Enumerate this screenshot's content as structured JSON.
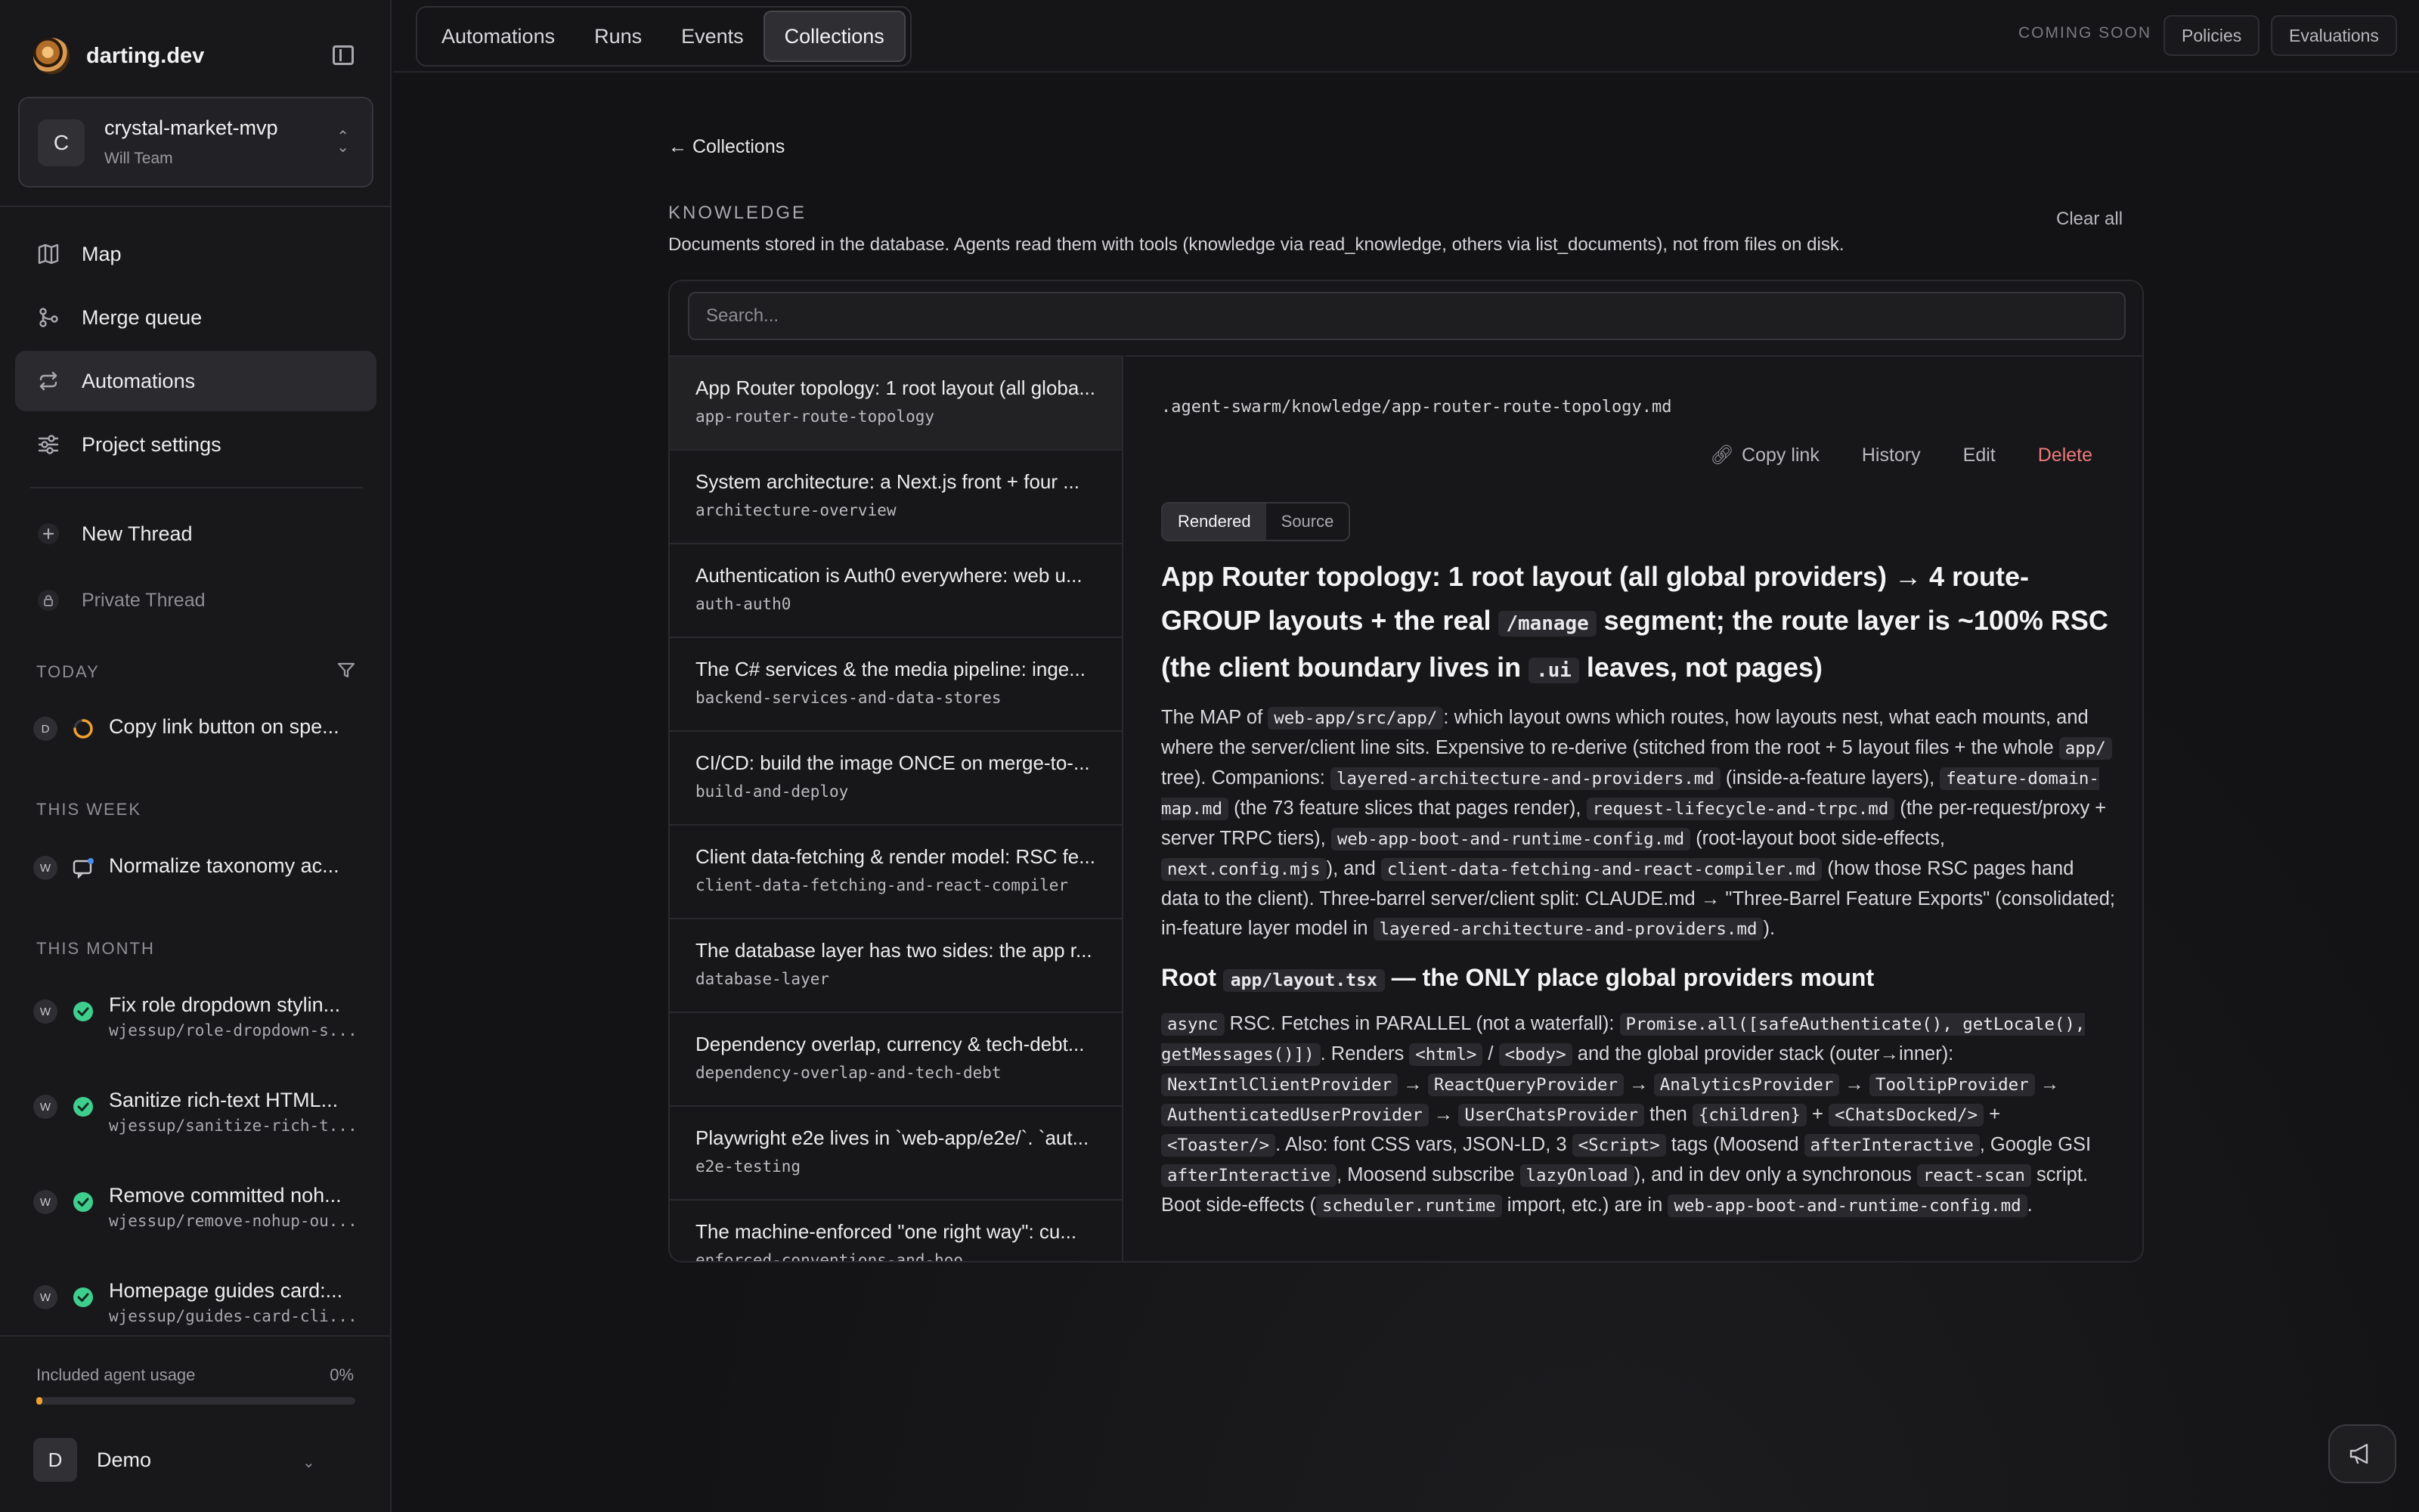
{
  "brand": {
    "name": "darting.dev"
  },
  "workspace": {
    "initial": "C",
    "name": "crystal-market-mvp",
    "team": "Will Team"
  },
  "nav": {
    "map": "Map",
    "merge_queue": "Merge queue",
    "automations": "Automations",
    "project_settings": "Project settings",
    "new_thread": "New Thread",
    "private_thread": "Private Thread"
  },
  "sections": {
    "today": "TODAY",
    "this_week": "THIS WEEK",
    "this_month": "THIS MONTH"
  },
  "threads": [
    {
      "avatar": "D",
      "title": "Copy link button on spe...",
      "sub": "",
      "status": "running"
    },
    {
      "avatar": "W",
      "title": "Normalize taxonomy ac...",
      "sub": "",
      "status": "chat"
    },
    {
      "avatar": "W",
      "title": "Fix role dropdown stylin...",
      "sub": "wjessup/role-dropdown-s...",
      "status": "done"
    },
    {
      "avatar": "W",
      "title": "Sanitize rich-text HTML...",
      "sub": "wjessup/sanitize-rich-t...",
      "status": "done"
    },
    {
      "avatar": "W",
      "title": "Remove committed noh...",
      "sub": "wjessup/remove-nohup-ou...",
      "status": "done"
    },
    {
      "avatar": "W",
      "title": "Homepage guides card:...",
      "sub": "wjessup/guides-card-cli...",
      "status": "done"
    }
  ],
  "usage": {
    "label": "Included agent usage",
    "percent_text": "0%",
    "percent": 0
  },
  "user": {
    "initial": "D",
    "name": "Demo"
  },
  "topbar": {
    "tabs": [
      "Automations",
      "Runs",
      "Events",
      "Collections"
    ],
    "active_tab": "Collections",
    "coming_soon": "COMING SOON",
    "policies": "Policies",
    "evaluations": "Evaluations"
  },
  "page": {
    "back": "← Collections",
    "title": "KNOWLEDGE",
    "description": "Documents stored in the database. Agents read them with tools (knowledge via read_knowledge, others via list_documents), not from files on disk.",
    "clear_all": "Clear all",
    "search_placeholder": "Search..."
  },
  "documents": [
    {
      "title": "App Router topology: 1 root layout (all globa...",
      "slug": "app-router-route-topology"
    },
    {
      "title": "System architecture: a Next.js front + four ...",
      "slug": "architecture-overview"
    },
    {
      "title": "Authentication is Auth0 everywhere: web u...",
      "slug": "auth-auth0"
    },
    {
      "title": "The C# services & the media pipeline: inge...",
      "slug": "backend-services-and-data-stores"
    },
    {
      "title": "CI/CD: build the image ONCE on merge-to-...",
      "slug": "build-and-deploy"
    },
    {
      "title": "Client data-fetching & render model: RSC fe...",
      "slug": "client-data-fetching-and-react-compiler"
    },
    {
      "title": "The database layer has two sides: the app r...",
      "slug": "database-layer"
    },
    {
      "title": "Dependency overlap, currency & tech-debt...",
      "slug": "dependency-overlap-and-tech-debt"
    },
    {
      "title": "Playwright e2e lives in `web-app/e2e/`. `aut...",
      "slug": "e2e-testing"
    },
    {
      "title": "The machine-enforced \"one right way\": cu...",
      "slug": "enforced-conventions-and-hoo"
    }
  ],
  "detail": {
    "path": ".agent-swarm/knowledge/app-router-route-topology.md",
    "copy_link": "Copy link",
    "history": "History",
    "edit": "Edit",
    "delete": "Delete",
    "rendered": "Rendered",
    "source": "Source",
    "h1": [
      {
        "t": "App Router topology: 1 root layout (all global providers) → 4 route-GROUP layouts + the real "
      },
      {
        "c": "/manage"
      },
      {
        "t": " segment; the route layer is ~100% RSC (the client boundary lives in "
      },
      {
        "c": ".ui"
      },
      {
        "t": " leaves, not pages)"
      }
    ],
    "p1": [
      {
        "t": "The MAP of "
      },
      {
        "c": "web-app/src/app/"
      },
      {
        "t": ": which layout owns which routes, how layouts nest, what each mounts, and where the server/client line sits. Expensive to re-derive (stitched from the root + 5 layout files + the whole "
      },
      {
        "c": "app/"
      },
      {
        "t": " tree). Companions: "
      },
      {
        "c": "layered-architecture-and-providers.md"
      },
      {
        "t": " (inside-a-feature layers), "
      },
      {
        "c": "feature-domain-map.md"
      },
      {
        "t": " (the 73 feature slices that pages render), "
      },
      {
        "c": "request-lifecycle-and-trpc.md"
      },
      {
        "t": " (the per-request/proxy + server TRPC tiers), "
      },
      {
        "c": "web-app-boot-and-runtime-config.md"
      },
      {
        "t": " (root-layout boot side-effects, "
      },
      {
        "c": "next.config.mjs"
      },
      {
        "t": "), and "
      },
      {
        "c": "client-data-fetching-and-react-compiler.md"
      },
      {
        "t": " (how those RSC pages hand data to the client). Three-barrel server/client split: CLAUDE.md → \"Three-Barrel Feature Exports\" (consolidated; in-feature layer model in "
      },
      {
        "c": "layered-architecture-and-providers.md"
      },
      {
        "t": ")."
      }
    ],
    "h2": [
      {
        "t": "Root "
      },
      {
        "c": "app/layout.tsx"
      },
      {
        "t": " — the ONLY place global providers mount"
      }
    ],
    "p2": [
      {
        "c": "async"
      },
      {
        "t": " RSC. Fetches in PARALLEL (not a waterfall): "
      },
      {
        "c": "Promise.all([safeAuthenticate(), getLocale(), getMessages()])"
      },
      {
        "t": ". Renders "
      },
      {
        "c": "<html>"
      },
      {
        "t": " / "
      },
      {
        "c": "<body>"
      },
      {
        "t": " and the global provider stack (outer→inner): "
      },
      {
        "c": "NextIntlClientProvider"
      },
      {
        "t": " → "
      },
      {
        "c": "ReactQueryProvider"
      },
      {
        "t": " → "
      },
      {
        "c": "AnalyticsProvider"
      },
      {
        "t": " → "
      },
      {
        "c": "TooltipProvider"
      },
      {
        "t": " → "
      },
      {
        "c": "AuthenticatedUserProvider"
      },
      {
        "t": " → "
      },
      {
        "c": "UserChatsProvider"
      },
      {
        "t": " then "
      },
      {
        "c": "{children}"
      },
      {
        "t": " + "
      },
      {
        "c": "<ChatsDocked/>"
      },
      {
        "t": " + "
      },
      {
        "c": "<Toaster/>"
      },
      {
        "t": ". Also: font CSS vars, JSON-LD, 3 "
      },
      {
        "c": "<Script>"
      },
      {
        "t": " tags (Moosend "
      },
      {
        "c": "afterInteractive"
      },
      {
        "t": ", Google GSI "
      },
      {
        "c": "afterInteractive"
      },
      {
        "t": ", Moosend subscribe "
      },
      {
        "c": "lazyOnload"
      },
      {
        "t": "), and in dev only a synchronous "
      },
      {
        "c": "react-scan"
      },
      {
        "t": " script. Boot side-effects ("
      },
      {
        "c": "scheduler.runtime"
      },
      {
        "t": " import, etc.) are in "
      },
      {
        "c": "web-app-boot-and-runtime-config.md"
      },
      {
        "t": "."
      }
    ]
  },
  "colors": {
    "accent_done": "#3ecf8e",
    "danger": "#f07a7a",
    "usage_fill": "#f0a030"
  }
}
